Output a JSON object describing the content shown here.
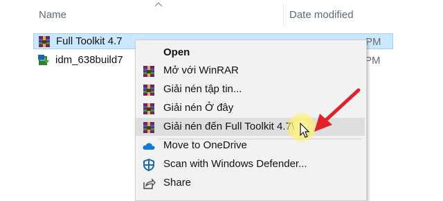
{
  "header": {
    "col_name": "Name",
    "col_date": "Date modified"
  },
  "files": [
    {
      "name": "Full Toolkit 4.7",
      "date": "PM",
      "icon": "winrar-archive-icon",
      "selected": true
    },
    {
      "name": "idm_638build7",
      "date": "PM",
      "icon": "installer-icon",
      "selected": false
    }
  ],
  "menu": {
    "open": "Open",
    "open_winrar": "Mở với WinRAR",
    "extract_files": "Giải nén tập tin...",
    "extract_here": "Giải nén Ở đây",
    "extract_to": "Giải nén đến Full Toolkit 4.7\\",
    "onedrive": "Move to OneDrive",
    "defender": "Scan with Windows Defender...",
    "share": "Share"
  },
  "colors": {
    "selection": "#cce8ff",
    "menu_bg": "#f2f2f2",
    "hover": "#dedede",
    "arrow": "#e0222a"
  }
}
